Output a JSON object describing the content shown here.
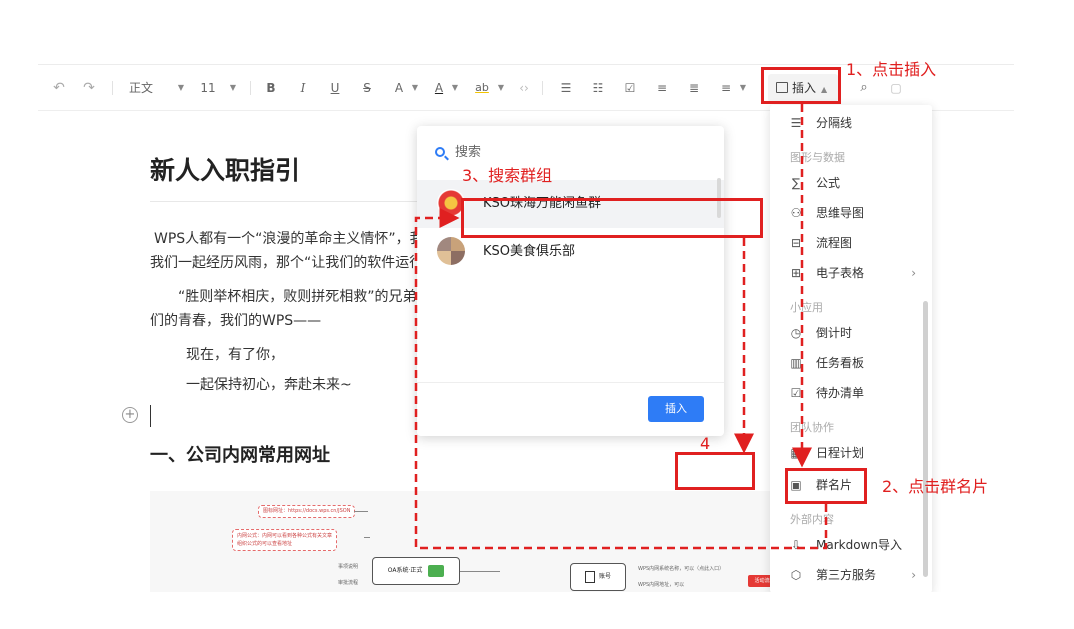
{
  "toolbar": {
    "paragraph_style": "正文",
    "font_size": "11",
    "bold": "B",
    "italic": "I",
    "underline": "U",
    "strikethrough": "S",
    "superscript": "A",
    "font_color": "A",
    "highlight": "ab",
    "insert_label": "插入"
  },
  "document": {
    "title": "新人入职指引",
    "paragraphs": [
      "WPS人都有一个“浪漫的革命主义情怀”，我们",
      "我们一起经历风雨，那个“让我们的软件运行在",
      "“胜则举杯相庆，败则拼死相救”的兄弟情谊",
      "们的青春，我们的WPS——",
      "现在，有了你，",
      "一起保持初心，奔赴未来~"
    ],
    "heading": "一、公司内网常用网址",
    "add_symbol": "+"
  },
  "mindmap": {
    "note1": "图标网址：https://docs.wps.cn/JSON",
    "note2": "内网公式：内网可以看到各种公式有关文章",
    "note2b": "组织公式的可以查看地址",
    "node_oa": "OA系统·正式",
    "node_right": "账号",
    "small1": "事项说明",
    "small2": "审批流程",
    "small3": "WPS内网系统名称，可以（点此入口）",
    "small4": "WPS内网地址，可以",
    "tag_right": "活动流程申请表"
  },
  "group_popup": {
    "search_placeholder": "搜索",
    "groups": [
      {
        "name": "KSO珠海万能闲鱼群"
      },
      {
        "name": "KSO美食俱乐部"
      }
    ],
    "insert_button": "插入"
  },
  "insert_menu": {
    "items": [
      {
        "label": "分隔线",
        "icon": "divider-icon",
        "glyph": "☰"
      },
      {
        "header": "图形与数据"
      },
      {
        "label": "公式",
        "icon": "formula-icon",
        "glyph": "∑"
      },
      {
        "label": "思维导图",
        "icon": "mindmap-icon",
        "glyph": "⚇"
      },
      {
        "label": "流程图",
        "icon": "flowchart-icon",
        "glyph": "⊟"
      },
      {
        "label": "电子表格",
        "icon": "spreadsheet-icon",
        "glyph": "⊞",
        "arrow": "›"
      },
      {
        "header": "小应用"
      },
      {
        "label": "倒计时",
        "icon": "countdown-icon",
        "glyph": "◷"
      },
      {
        "label": "任务看板",
        "icon": "task-board-icon",
        "glyph": "▥"
      },
      {
        "label": "待办清单",
        "icon": "todo-list-icon",
        "glyph": "☑"
      },
      {
        "header": "团队协作"
      },
      {
        "label": "日程计划",
        "icon": "schedule-icon",
        "glyph": "▦"
      },
      {
        "label": "群名片",
        "icon": "group-card-icon",
        "glyph": "▣"
      },
      {
        "header": "外部内容"
      },
      {
        "label": "Markdown导入",
        "icon": "markdown-import-icon",
        "glyph": "⇩"
      },
      {
        "label": "第三方服务",
        "icon": "third-party-icon",
        "glyph": "⬡",
        "arrow": "›"
      }
    ]
  },
  "annotations": {
    "step1": "1、点击插入",
    "step2": "2、点击群名片",
    "step3": "3、搜索群组",
    "step4": "4",
    "color": "#e02020"
  },
  "colors": {
    "accent": "#2e7cf6",
    "annotation_red": "#e02020"
  }
}
